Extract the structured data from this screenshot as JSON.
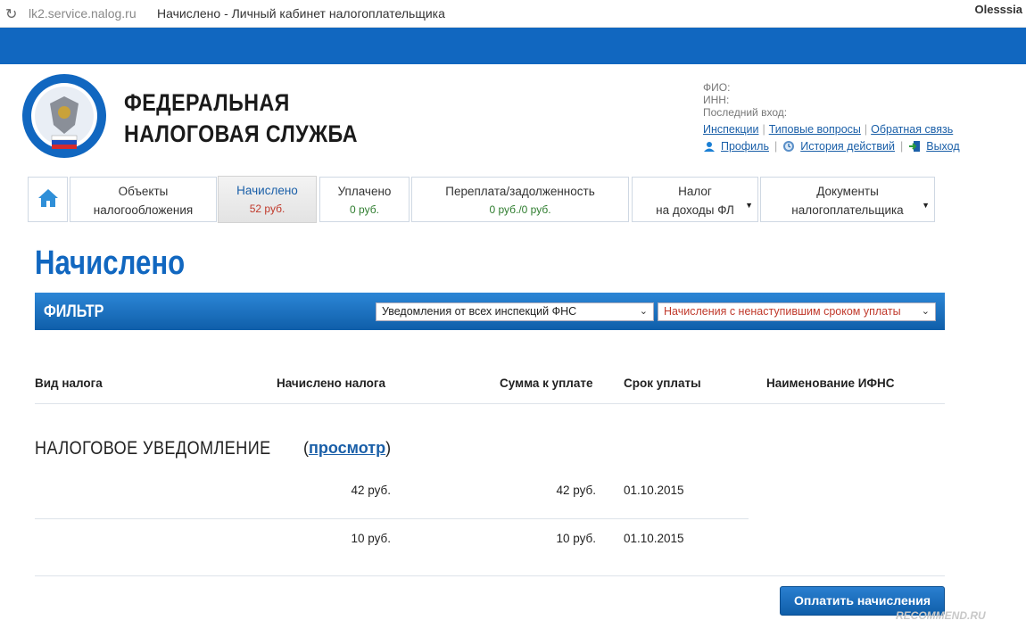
{
  "browser": {
    "url": "lk2.service.nalog.ru",
    "page_title": "Начислено - Личный кабинет налогоплательщика",
    "user": "Olesssia"
  },
  "header": {
    "org_line1": "ФЕДЕРАЛЬНАЯ",
    "org_line2": "НАЛОГОВАЯ СЛУЖБА",
    "fio_label": "ФИО:",
    "inn_label": "ИНН:",
    "last_login_label": "Последний вход:",
    "links": {
      "inspections": "Инспекции",
      "faq": "Типовые вопросы",
      "feedback": "Обратная связь"
    },
    "profile": "Профиль",
    "history": "История действий",
    "logout": "Выход"
  },
  "tabs": [
    {
      "line1": "Объекты",
      "line2": "налогообложения"
    },
    {
      "line1": "Начислено",
      "line2": "52 руб."
    },
    {
      "line1": "Уплачено",
      "line2": "0 руб."
    },
    {
      "line1": "Переплата/задолженность",
      "line2": "0 руб./0 руб."
    },
    {
      "line1": "Налог",
      "line2": "на доходы ФЛ"
    },
    {
      "line1": "Документы",
      "line2": "налогоплательщика"
    }
  ],
  "page_title": "Начислено",
  "filter": {
    "label": "ФИЛЬТР",
    "select1": "Уведомления от всех инспекций ФНС",
    "select2": "Начисления с ненаступившим сроком уплаты"
  },
  "table": {
    "headers": [
      "Вид налога",
      "Начислено налога",
      "Сумма к уплате",
      "Срок уплаты",
      "Наименование ИФНС"
    ],
    "notice_title": "НАЛОГОВОЕ УВЕДОМЛЕНИЕ",
    "view_open": "(",
    "view_link": "просмотр",
    "view_close": ")",
    "rows": [
      {
        "accrued": "42 руб.",
        "payable": "42 руб.",
        "due": "01.10.2015"
      },
      {
        "accrued": "10 руб.",
        "payable": "10 руб.",
        "due": "01.10.2015"
      }
    ]
  },
  "pay_button": "Оплатить начисления",
  "watermark": "RECOMMEND.RU",
  "colors": {
    "brand_blue": "#1167c0",
    "link": "#1a5fa8",
    "amount_red": "#c0392b",
    "amount_green": "#2f7d2f"
  }
}
